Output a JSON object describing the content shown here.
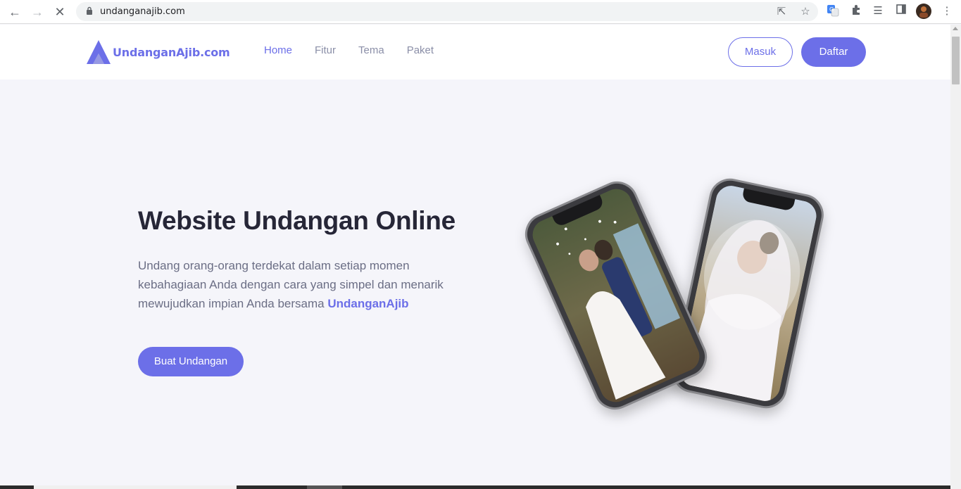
{
  "browser": {
    "url": "undanganajib.com"
  },
  "header": {
    "logo_text": "UndanganAjib.com",
    "menu": [
      {
        "label": "Home"
      },
      {
        "label": "Fitur"
      },
      {
        "label": "Tema"
      },
      {
        "label": "Paket"
      }
    ],
    "login_label": "Masuk",
    "register_label": "Daftar"
  },
  "hero": {
    "title": "Website Undangan Online",
    "desc_part1": "Undang orang-orang terdekat dalam setiap momen kebahagiaan Anda dengan cara yang simpel dan menarik mewujudkan impian Anda bersama ",
    "desc_brand": "UndanganAjib",
    "cta_label": "Buat Undangan"
  },
  "colors": {
    "brand": "#6c6fe8",
    "heading": "#262637",
    "body_text": "#6b6e85",
    "page_bg": "#f5f5fa"
  }
}
